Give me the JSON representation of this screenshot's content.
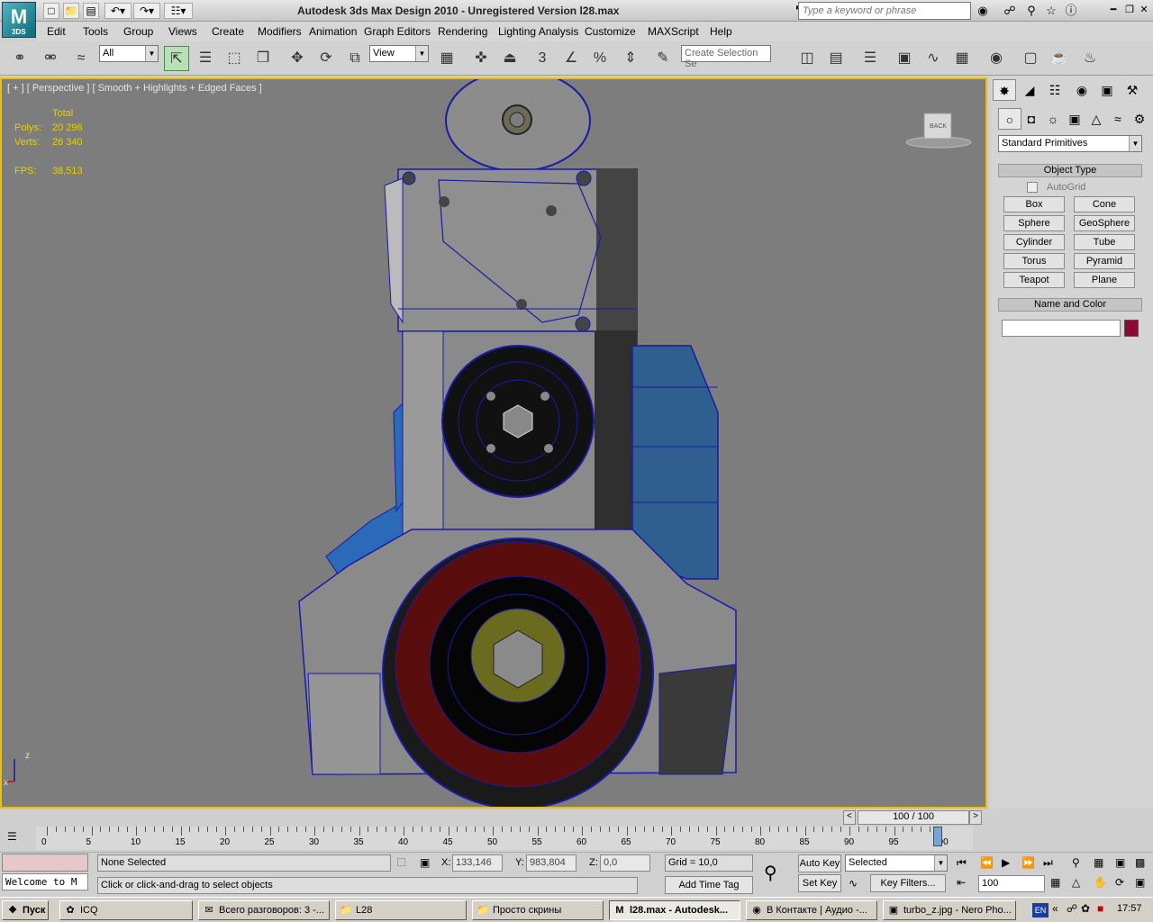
{
  "app": {
    "logo_text": "3DS",
    "title": "Autodesk 3ds Max Design 2010  -  Unregistered Version     l28.max",
    "search_placeholder": "Type a keyword or phrase"
  },
  "menu": [
    "Edit",
    "Tools",
    "Group",
    "Views",
    "Create",
    "Modifiers",
    "Animation",
    "Graph Editors",
    "Rendering",
    "Lighting Analysis",
    "Customize",
    "MAXScript",
    "Help"
  ],
  "toolbar": {
    "filter_value": "All",
    "refcoord_value": "View",
    "selection_set_placeholder": "Create Selection Se",
    "snap_label": "3",
    "pct_label": "%"
  },
  "viewport": {
    "label": "[ + ] [ Perspective ] [ Smooth + Highlights + Edged Faces ]",
    "stats": {
      "total_label": "Total",
      "polys_label": "Polys:",
      "polys_value": "20 296",
      "verts_label": "Verts:",
      "verts_value": "26 340",
      "fps_label": "FPS:",
      "fps_value": "38,513"
    },
    "viewcube_label": "BACK",
    "axis_z": "z",
    "axis_x": "x"
  },
  "command_panel": {
    "category": "Standard Primitives",
    "object_type_title": "Object Type",
    "autogrid_label": "AutoGrid",
    "buttons": [
      "Box",
      "Cone",
      "Sphere",
      "GeoSphere",
      "Cylinder",
      "Tube",
      "Torus",
      "Pyramid",
      "Teapot",
      "Plane"
    ],
    "name_color_title": "Name and Color",
    "name_value": "",
    "color": "#8a0a35"
  },
  "timeline": {
    "slider_label": "100 / 100",
    "ticks": [
      "0",
      "5",
      "10",
      "15",
      "20",
      "25",
      "30",
      "35",
      "40",
      "45",
      "50",
      "55",
      "60",
      "65",
      "70",
      "75",
      "80",
      "85",
      "90",
      "95",
      "100"
    ]
  },
  "status": {
    "listener_text": "Welcome to M",
    "selection_text": "None Selected",
    "prompt_text": "Click or click-and-drag to select objects",
    "x_label": "X:",
    "x_value": "133,146",
    "y_label": "Y:",
    "y_value": "983,804",
    "z_label": "Z:",
    "z_value": "0,0",
    "grid_text": "Grid = 10,0",
    "add_time_tag": "Add Time Tag",
    "auto_key": "Auto Key",
    "set_key": "Set Key",
    "selected_value": "Selected",
    "key_filters": "Key Filters...",
    "frame_value": "100"
  },
  "taskbar": {
    "start": "Пуск",
    "items": [
      {
        "label": "ICQ",
        "icon": "flower-icon"
      },
      {
        "label": "Всего разговоров: 3 -...",
        "icon": "chat-icon"
      },
      {
        "label": "L28",
        "icon": "folder-icon"
      },
      {
        "label": "Просто скрины",
        "icon": "folder-icon"
      },
      {
        "label": "l28.max - Autodesk...",
        "icon": "max-icon"
      },
      {
        "label": "В Контакте | Аудио -...",
        "icon": "firefox-icon"
      },
      {
        "label": "turbo_z.jpg - Nero Pho...",
        "icon": "image-icon"
      }
    ],
    "lang": "EN",
    "clock": "17:57"
  }
}
